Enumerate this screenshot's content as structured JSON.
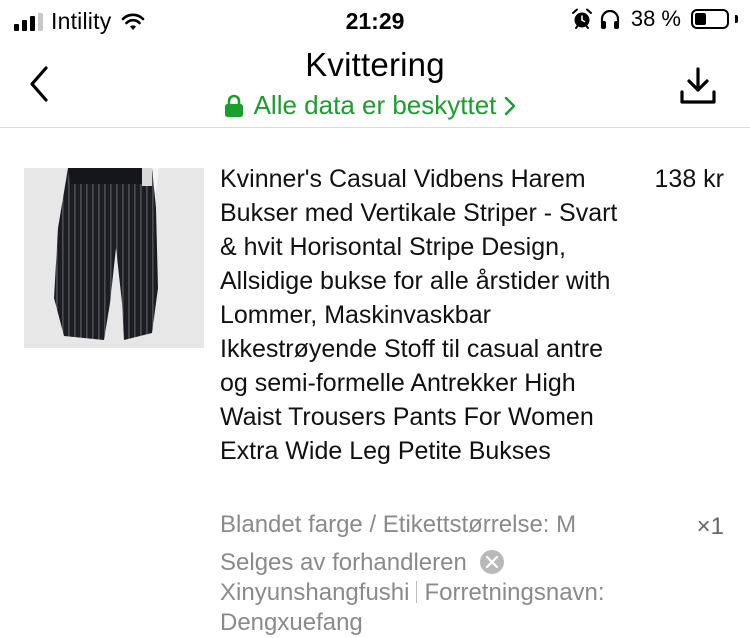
{
  "status_bar": {
    "carrier": "Intility",
    "time": "21:29",
    "battery_percent": "38 %",
    "battery_level": 0.38,
    "icons": [
      "signal-icon",
      "wifi-icon",
      "alarm-icon",
      "headphones-icon",
      "battery-icon"
    ]
  },
  "nav": {
    "title": "Kvittering",
    "secure_label": "Alle data er beskyttet",
    "icons": [
      "back-chevron-icon",
      "lock-icon",
      "chevron-right-icon",
      "download-icon"
    ],
    "accent_color": "#1a9f2c"
  },
  "item": {
    "title": "Kvinner's Casual Vidbens Harem Bukser med Vertikale Striper - Svart & hvit Horisontal Stripe Design, Allsidige bukse for alle årstider with Lommer, Maskinvaskbar Ikkestrøyende Stoff til casual antre og semi-formelle Antrekker High Waist Trousers Pants For Women Extra Wide Leg Petite Bukses",
    "price": "138 kr",
    "variant": "Blandet farge / Etikettstørrelse: M",
    "quantity": "×1",
    "seller_prefix": "Selges av forhandleren",
    "seller_name": "Xinyunshangfushi",
    "business_name_label": "Forretningsnavn:",
    "business_name": "Dengxuefang"
  }
}
